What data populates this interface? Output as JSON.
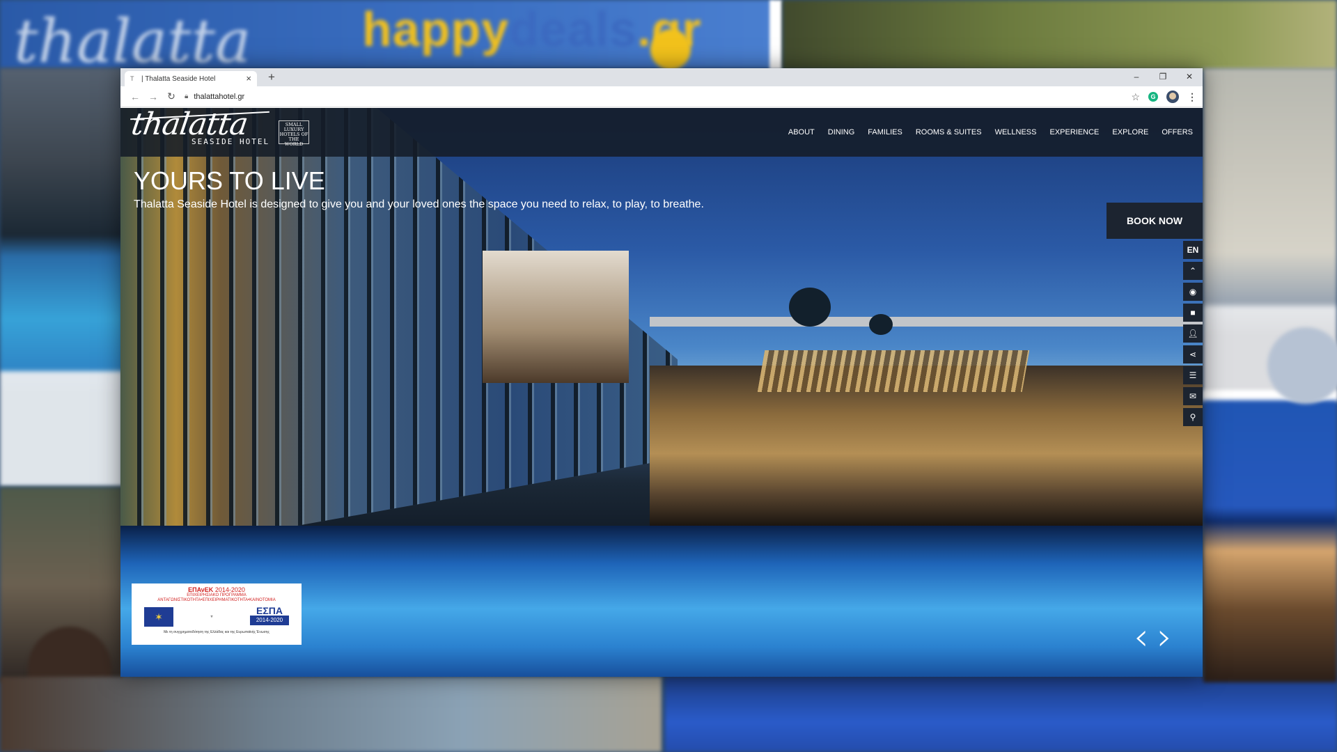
{
  "backdrop": {
    "signature_text": "thalatta",
    "brand_happy": "happy",
    "brand_deals": "deals",
    "brand_gr": ".gr"
  },
  "browser": {
    "tab_title": "| Thalatta Seaside Hotel",
    "tab_favicon": "T",
    "new_tab": "+",
    "url": "thalattahotel.gr",
    "window_controls": [
      "–",
      "❐",
      "✕"
    ]
  },
  "site": {
    "logo_script": "thalatta",
    "logo_sub": "SEASIDE HOTEL",
    "slh_badge": "SMALL LUXURY HOTELS OF THE WORLD",
    "nav": [
      "ABOUT",
      "DINING",
      "FAMILIES",
      "ROOMS & SUITES",
      "WELLNESS",
      "EXPERIENCE",
      "EXPLORE",
      "OFFERS"
    ],
    "hero_title": "YOURS TO LIVE",
    "hero_subtitle": "Thalatta Seaside Hotel is designed to give you and your loved ones the space you need to relax, to play, to breathe.",
    "book_now": "BOOK NOW",
    "language": "EN",
    "side_icons": [
      "chevron-up-icon",
      "camera-icon",
      "video-icon",
      "users-icon",
      "share-icon",
      "document-icon",
      "mail-icon",
      "location-pin-icon"
    ],
    "espa": {
      "title": "ΕΠΑνΕΚ",
      "years": "2014-2020",
      "line1": "ΕΠΙΧΕΙΡΗΣΙΑΚΟ ΠΡΟΓΡΑΜΜΑ",
      "line2": "ΑΝΤΑΓΩΝΙΣΤΙΚΟΤΗΤΑ•ΕΠΙΧΕΙΡΗΜΑΤΙΚΟΤΗΤΑ•ΚΑΙΝΟΤΟΜΙΑ",
      "espa_logo": "ΕΣΠΑ",
      "espa_years": "2014-2020",
      "footer": "Με τη συγχρηματοδότηση της Ελλάδας και της Ευρωπαϊκής Ένωσης"
    },
    "prev_arrow": "‹",
    "next_arrow": "›"
  }
}
